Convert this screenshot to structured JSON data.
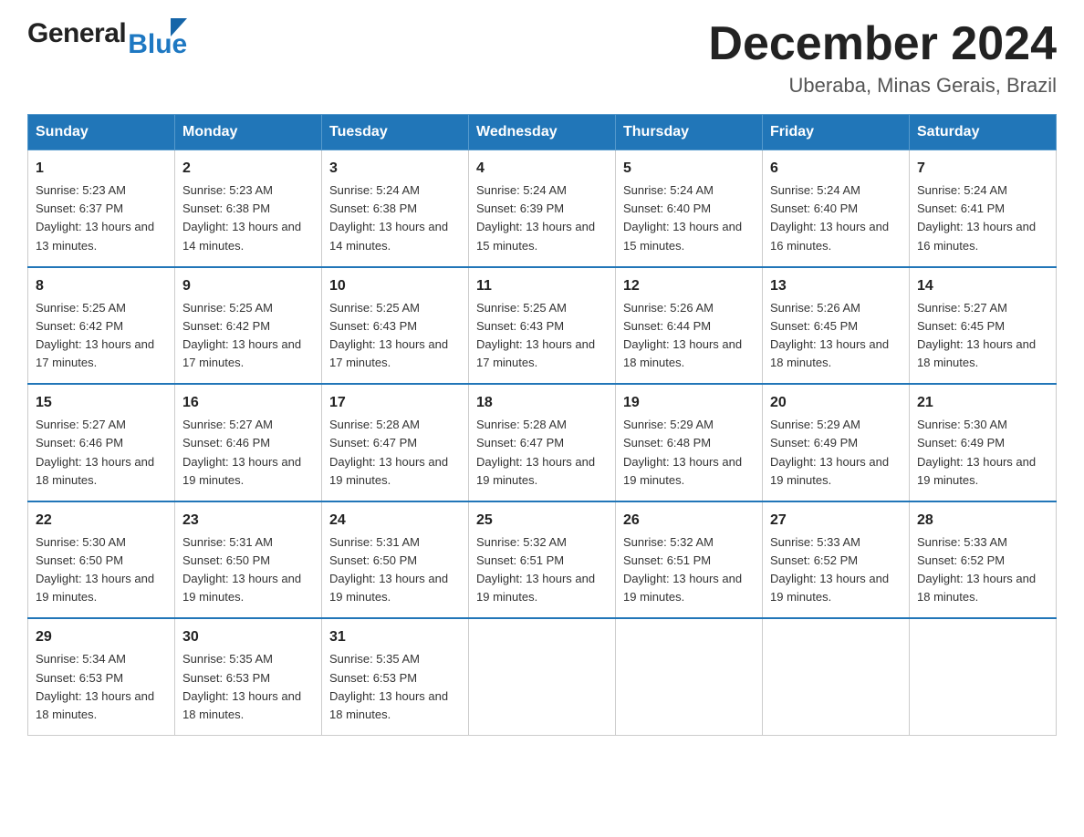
{
  "logo": {
    "general": "General",
    "blue": "Blue"
  },
  "header": {
    "title": "December 2024",
    "location": "Uberaba, Minas Gerais, Brazil"
  },
  "weekdays": [
    "Sunday",
    "Monday",
    "Tuesday",
    "Wednesday",
    "Thursday",
    "Friday",
    "Saturday"
  ],
  "weeks": [
    [
      {
        "day": "1",
        "sunrise": "5:23 AM",
        "sunset": "6:37 PM",
        "daylight": "13 hours and 13 minutes."
      },
      {
        "day": "2",
        "sunrise": "5:23 AM",
        "sunset": "6:38 PM",
        "daylight": "13 hours and 14 minutes."
      },
      {
        "day": "3",
        "sunrise": "5:24 AM",
        "sunset": "6:38 PM",
        "daylight": "13 hours and 14 minutes."
      },
      {
        "day": "4",
        "sunrise": "5:24 AM",
        "sunset": "6:39 PM",
        "daylight": "13 hours and 15 minutes."
      },
      {
        "day": "5",
        "sunrise": "5:24 AM",
        "sunset": "6:40 PM",
        "daylight": "13 hours and 15 minutes."
      },
      {
        "day": "6",
        "sunrise": "5:24 AM",
        "sunset": "6:40 PM",
        "daylight": "13 hours and 16 minutes."
      },
      {
        "day": "7",
        "sunrise": "5:24 AM",
        "sunset": "6:41 PM",
        "daylight": "13 hours and 16 minutes."
      }
    ],
    [
      {
        "day": "8",
        "sunrise": "5:25 AM",
        "sunset": "6:42 PM",
        "daylight": "13 hours and 17 minutes."
      },
      {
        "day": "9",
        "sunrise": "5:25 AM",
        "sunset": "6:42 PM",
        "daylight": "13 hours and 17 minutes."
      },
      {
        "day": "10",
        "sunrise": "5:25 AM",
        "sunset": "6:43 PM",
        "daylight": "13 hours and 17 minutes."
      },
      {
        "day": "11",
        "sunrise": "5:25 AM",
        "sunset": "6:43 PM",
        "daylight": "13 hours and 17 minutes."
      },
      {
        "day": "12",
        "sunrise": "5:26 AM",
        "sunset": "6:44 PM",
        "daylight": "13 hours and 18 minutes."
      },
      {
        "day": "13",
        "sunrise": "5:26 AM",
        "sunset": "6:45 PM",
        "daylight": "13 hours and 18 minutes."
      },
      {
        "day": "14",
        "sunrise": "5:27 AM",
        "sunset": "6:45 PM",
        "daylight": "13 hours and 18 minutes."
      }
    ],
    [
      {
        "day": "15",
        "sunrise": "5:27 AM",
        "sunset": "6:46 PM",
        "daylight": "13 hours and 18 minutes."
      },
      {
        "day": "16",
        "sunrise": "5:27 AM",
        "sunset": "6:46 PM",
        "daylight": "13 hours and 19 minutes."
      },
      {
        "day": "17",
        "sunrise": "5:28 AM",
        "sunset": "6:47 PM",
        "daylight": "13 hours and 19 minutes."
      },
      {
        "day": "18",
        "sunrise": "5:28 AM",
        "sunset": "6:47 PM",
        "daylight": "13 hours and 19 minutes."
      },
      {
        "day": "19",
        "sunrise": "5:29 AM",
        "sunset": "6:48 PM",
        "daylight": "13 hours and 19 minutes."
      },
      {
        "day": "20",
        "sunrise": "5:29 AM",
        "sunset": "6:49 PM",
        "daylight": "13 hours and 19 minutes."
      },
      {
        "day": "21",
        "sunrise": "5:30 AM",
        "sunset": "6:49 PM",
        "daylight": "13 hours and 19 minutes."
      }
    ],
    [
      {
        "day": "22",
        "sunrise": "5:30 AM",
        "sunset": "6:50 PM",
        "daylight": "13 hours and 19 minutes."
      },
      {
        "day": "23",
        "sunrise": "5:31 AM",
        "sunset": "6:50 PM",
        "daylight": "13 hours and 19 minutes."
      },
      {
        "day": "24",
        "sunrise": "5:31 AM",
        "sunset": "6:50 PM",
        "daylight": "13 hours and 19 minutes."
      },
      {
        "day": "25",
        "sunrise": "5:32 AM",
        "sunset": "6:51 PM",
        "daylight": "13 hours and 19 minutes."
      },
      {
        "day": "26",
        "sunrise": "5:32 AM",
        "sunset": "6:51 PM",
        "daylight": "13 hours and 19 minutes."
      },
      {
        "day": "27",
        "sunrise": "5:33 AM",
        "sunset": "6:52 PM",
        "daylight": "13 hours and 19 minutes."
      },
      {
        "day": "28",
        "sunrise": "5:33 AM",
        "sunset": "6:52 PM",
        "daylight": "13 hours and 18 minutes."
      }
    ],
    [
      {
        "day": "29",
        "sunrise": "5:34 AM",
        "sunset": "6:53 PM",
        "daylight": "13 hours and 18 minutes."
      },
      {
        "day": "30",
        "sunrise": "5:35 AM",
        "sunset": "6:53 PM",
        "daylight": "13 hours and 18 minutes."
      },
      {
        "day": "31",
        "sunrise": "5:35 AM",
        "sunset": "6:53 PM",
        "daylight": "13 hours and 18 minutes."
      },
      null,
      null,
      null,
      null
    ]
  ],
  "labels": {
    "sunrise_prefix": "Sunrise: ",
    "sunset_prefix": "Sunset: ",
    "daylight_prefix": "Daylight: "
  },
  "colors": {
    "header_bg": "#2176b8",
    "header_text": "#ffffff",
    "border": "#2176b8",
    "accent": "#1e78c2"
  }
}
